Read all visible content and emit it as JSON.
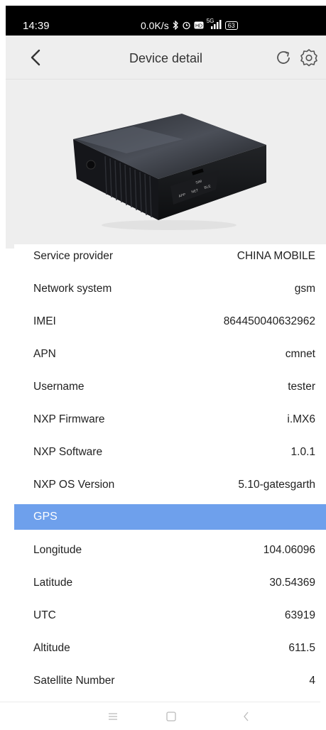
{
  "status_bar": {
    "time": "14:39",
    "net_speed": "0.0K/s",
    "signal_label": "5G",
    "battery": "63",
    "icons": [
      "bluetooth-icon",
      "alarm-icon",
      "hd-icon",
      "signal-icon",
      "battery-icon"
    ]
  },
  "header": {
    "title": "Device detail",
    "icons": [
      "back-arrow-icon",
      "refresh-icon",
      "settings-gear-icon"
    ]
  },
  "rows": [
    {
      "label": "Service provider",
      "value": "CHINA MOBILE"
    },
    {
      "label": "Network system",
      "value": "gsm"
    },
    {
      "label": "IMEI",
      "value": "864450040632962"
    },
    {
      "label": "APN",
      "value": "cmnet"
    },
    {
      "label": "Username",
      "value": "tester"
    },
    {
      "label": "NXP Firmware",
      "value": "i.MX6"
    },
    {
      "label": "NXP Software",
      "value": "1.0.1"
    },
    {
      "label": "NXP OS Version",
      "value": "5.10-gatesgarth"
    }
  ],
  "gps_section": {
    "title": "GPS",
    "rows": [
      {
        "label": "Longitude",
        "value": "104.06096"
      },
      {
        "label": "Latitude",
        "value": "30.54369"
      },
      {
        "label": "UTC",
        "value": "63919"
      },
      {
        "label": "Altitude",
        "value": "611.5"
      },
      {
        "label": "Satellite Number",
        "value": "4"
      }
    ]
  },
  "device_image": {
    "port_labels": [
      "SIM",
      "APP",
      "NET",
      "BLE"
    ]
  },
  "navbar": {
    "icons": [
      "menu-icon",
      "home-icon",
      "back-icon"
    ]
  },
  "colors": {
    "section_header": "#6ea0ec",
    "header_bg": "#eeeeee",
    "status_bar_bg": "#000000"
  }
}
